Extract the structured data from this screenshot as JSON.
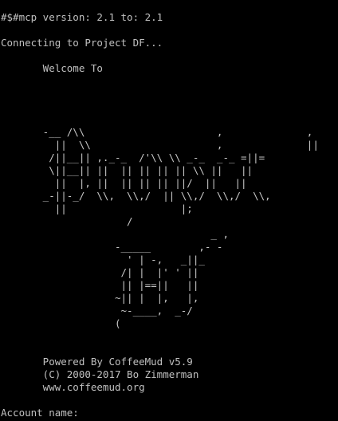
{
  "terminal": {
    "header_lines": [
      "#$#mcp version: 2.1 to: 2.1",
      "",
      "Connecting to Project DF...",
      "",
      "       Welcome To",
      "",
      "",
      "",
      "",
      "       -__ /\\\\                      ,              ,",
      "         ||  \\\\                     ,              ||",
      "        /||__|| ,._-_  /'\\\\ \\\\ _-_  _-_ =||=",
      "        \\||__|| ||  || || || || \\\\ ||   ||",
      "         ||  |, ||  || || || ||/  ||   ||",
      "       _-||-_/  \\\\,  \\\\,/  || \\\\,/  \\\\,/  \\\\,",
      "         ||                   |;",
      "                     /",
      "                                   _ ,",
      "                   -_____        ,- -",
      "                     ' | -,   _||_",
      "                    /| |  |' ' ||",
      "                    || |==||   ||",
      "                   ~|| |  |,   |,",
      "                    ~-____,  _-/",
      "                   (",
      "",
      "",
      "       Powered By CoffeeMud v5.9",
      "       (C) 2000-2017 Bo Zimmerman",
      "       www.coffeemud.org",
      ""
    ],
    "prompt_label": "Account name: ",
    "input_value": ""
  }
}
